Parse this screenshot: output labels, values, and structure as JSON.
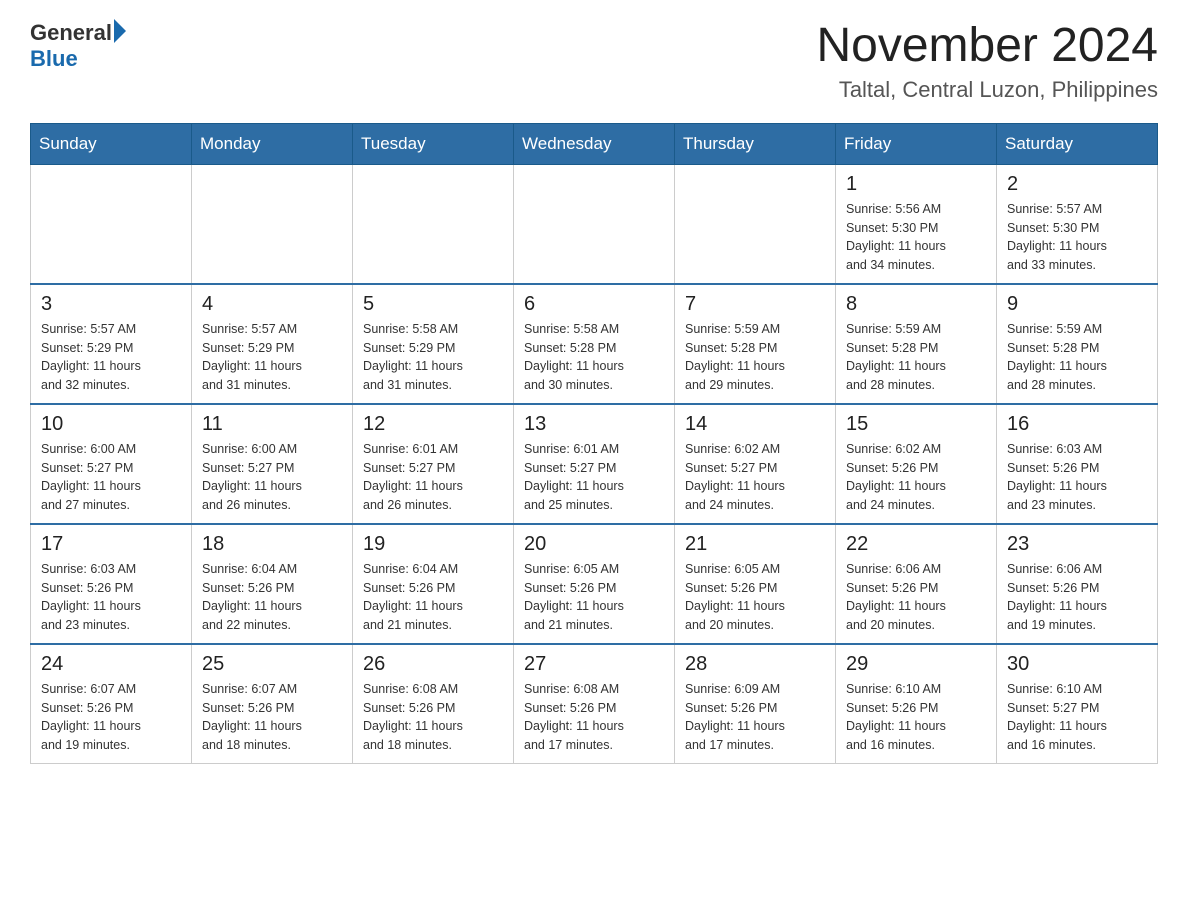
{
  "header": {
    "logo_general": "General",
    "logo_blue": "Blue",
    "title": "November 2024",
    "subtitle": "Taltal, Central Luzon, Philippines"
  },
  "weekdays": [
    "Sunday",
    "Monday",
    "Tuesday",
    "Wednesday",
    "Thursday",
    "Friday",
    "Saturday"
  ],
  "weeks": [
    [
      {
        "day": "",
        "info": ""
      },
      {
        "day": "",
        "info": ""
      },
      {
        "day": "",
        "info": ""
      },
      {
        "day": "",
        "info": ""
      },
      {
        "day": "",
        "info": ""
      },
      {
        "day": "1",
        "info": "Sunrise: 5:56 AM\nSunset: 5:30 PM\nDaylight: 11 hours\nand 34 minutes."
      },
      {
        "day": "2",
        "info": "Sunrise: 5:57 AM\nSunset: 5:30 PM\nDaylight: 11 hours\nand 33 minutes."
      }
    ],
    [
      {
        "day": "3",
        "info": "Sunrise: 5:57 AM\nSunset: 5:29 PM\nDaylight: 11 hours\nand 32 minutes."
      },
      {
        "day": "4",
        "info": "Sunrise: 5:57 AM\nSunset: 5:29 PM\nDaylight: 11 hours\nand 31 minutes."
      },
      {
        "day": "5",
        "info": "Sunrise: 5:58 AM\nSunset: 5:29 PM\nDaylight: 11 hours\nand 31 minutes."
      },
      {
        "day": "6",
        "info": "Sunrise: 5:58 AM\nSunset: 5:28 PM\nDaylight: 11 hours\nand 30 minutes."
      },
      {
        "day": "7",
        "info": "Sunrise: 5:59 AM\nSunset: 5:28 PM\nDaylight: 11 hours\nand 29 minutes."
      },
      {
        "day": "8",
        "info": "Sunrise: 5:59 AM\nSunset: 5:28 PM\nDaylight: 11 hours\nand 28 minutes."
      },
      {
        "day": "9",
        "info": "Sunrise: 5:59 AM\nSunset: 5:28 PM\nDaylight: 11 hours\nand 28 minutes."
      }
    ],
    [
      {
        "day": "10",
        "info": "Sunrise: 6:00 AM\nSunset: 5:27 PM\nDaylight: 11 hours\nand 27 minutes."
      },
      {
        "day": "11",
        "info": "Sunrise: 6:00 AM\nSunset: 5:27 PM\nDaylight: 11 hours\nand 26 minutes."
      },
      {
        "day": "12",
        "info": "Sunrise: 6:01 AM\nSunset: 5:27 PM\nDaylight: 11 hours\nand 26 minutes."
      },
      {
        "day": "13",
        "info": "Sunrise: 6:01 AM\nSunset: 5:27 PM\nDaylight: 11 hours\nand 25 minutes."
      },
      {
        "day": "14",
        "info": "Sunrise: 6:02 AM\nSunset: 5:27 PM\nDaylight: 11 hours\nand 24 minutes."
      },
      {
        "day": "15",
        "info": "Sunrise: 6:02 AM\nSunset: 5:26 PM\nDaylight: 11 hours\nand 24 minutes."
      },
      {
        "day": "16",
        "info": "Sunrise: 6:03 AM\nSunset: 5:26 PM\nDaylight: 11 hours\nand 23 minutes."
      }
    ],
    [
      {
        "day": "17",
        "info": "Sunrise: 6:03 AM\nSunset: 5:26 PM\nDaylight: 11 hours\nand 23 minutes."
      },
      {
        "day": "18",
        "info": "Sunrise: 6:04 AM\nSunset: 5:26 PM\nDaylight: 11 hours\nand 22 minutes."
      },
      {
        "day": "19",
        "info": "Sunrise: 6:04 AM\nSunset: 5:26 PM\nDaylight: 11 hours\nand 21 minutes."
      },
      {
        "day": "20",
        "info": "Sunrise: 6:05 AM\nSunset: 5:26 PM\nDaylight: 11 hours\nand 21 minutes."
      },
      {
        "day": "21",
        "info": "Sunrise: 6:05 AM\nSunset: 5:26 PM\nDaylight: 11 hours\nand 20 minutes."
      },
      {
        "day": "22",
        "info": "Sunrise: 6:06 AM\nSunset: 5:26 PM\nDaylight: 11 hours\nand 20 minutes."
      },
      {
        "day": "23",
        "info": "Sunrise: 6:06 AM\nSunset: 5:26 PM\nDaylight: 11 hours\nand 19 minutes."
      }
    ],
    [
      {
        "day": "24",
        "info": "Sunrise: 6:07 AM\nSunset: 5:26 PM\nDaylight: 11 hours\nand 19 minutes."
      },
      {
        "day": "25",
        "info": "Sunrise: 6:07 AM\nSunset: 5:26 PM\nDaylight: 11 hours\nand 18 minutes."
      },
      {
        "day": "26",
        "info": "Sunrise: 6:08 AM\nSunset: 5:26 PM\nDaylight: 11 hours\nand 18 minutes."
      },
      {
        "day": "27",
        "info": "Sunrise: 6:08 AM\nSunset: 5:26 PM\nDaylight: 11 hours\nand 17 minutes."
      },
      {
        "day": "28",
        "info": "Sunrise: 6:09 AM\nSunset: 5:26 PM\nDaylight: 11 hours\nand 17 minutes."
      },
      {
        "day": "29",
        "info": "Sunrise: 6:10 AM\nSunset: 5:26 PM\nDaylight: 11 hours\nand 16 minutes."
      },
      {
        "day": "30",
        "info": "Sunrise: 6:10 AM\nSunset: 5:27 PM\nDaylight: 11 hours\nand 16 minutes."
      }
    ]
  ]
}
